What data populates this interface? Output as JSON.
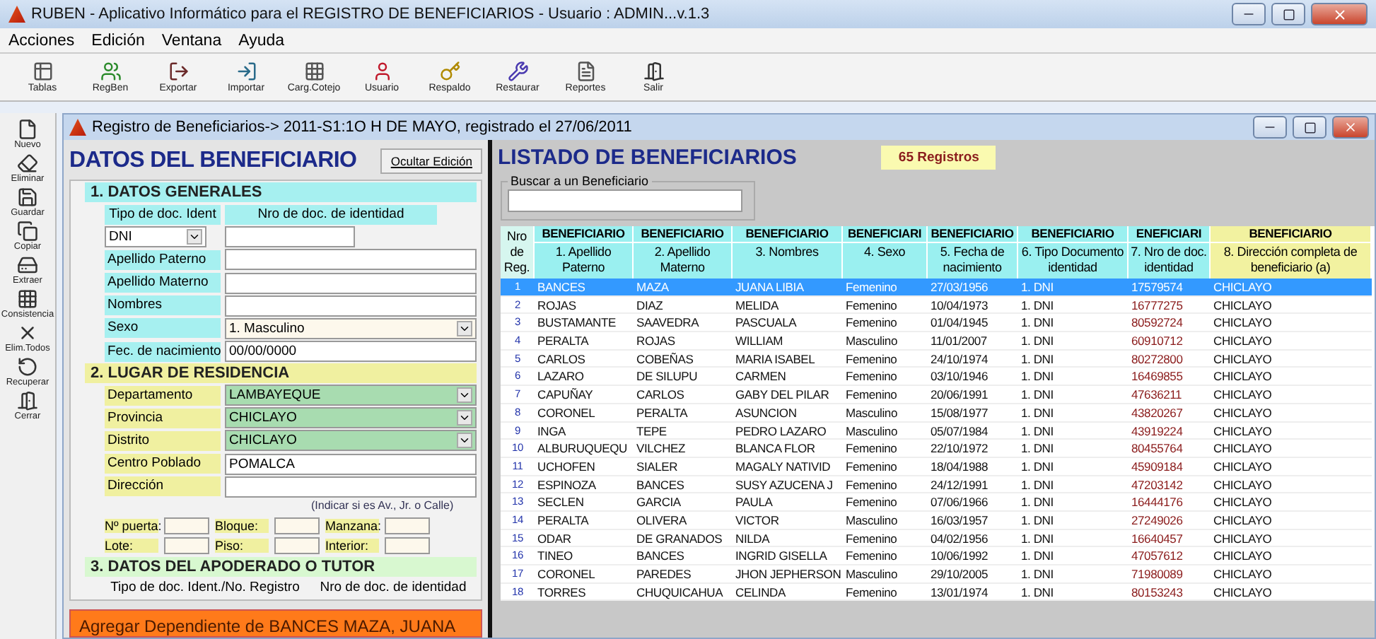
{
  "window": {
    "title": "RUBEN - Aplicativo Informático para el REGISTRO DE BENEFICIARIOS   - Usuario : ADMIN...v.1.3"
  },
  "menu": [
    "Acciones",
    "Edición",
    "Ventana",
    "Ayuda"
  ],
  "toolbar": [
    "Tablas",
    "RegBen",
    "Exportar",
    "Importar",
    "Carg.Cotejo",
    "Usuario",
    "Respaldo",
    "Restaurar",
    "Reportes",
    "Salir"
  ],
  "sidebar": [
    "Nuevo",
    "Eliminar",
    "Guardar",
    "Copiar",
    "Extraer",
    "Consistencia",
    "Elim.Todos",
    "Recuperar",
    "Cerrar"
  ],
  "child_window": {
    "title": "Registro de Beneficiarios-> 2011-S1:1O H DE MAYO, registrado el 27/06/2011"
  },
  "form": {
    "title": "DATOS DEL BENEFICIARIO",
    "hide_button": "Ocultar Edición",
    "sections": [
      {
        "title": "1. DATOS GENERALES",
        "color": "#a6f0f0",
        "rows": [
          {
            "kind": "headers",
            "labels": [
              "Tipo de doc. Ident",
              "Nro de doc. de identidad"
            ]
          },
          {
            "kind": "doc",
            "value": "DNI"
          },
          {
            "kind": "input",
            "label": "Apellido Paterno"
          },
          {
            "kind": "input",
            "label": "Apellido Materno"
          },
          {
            "kind": "input",
            "label": "Nombres"
          },
          {
            "kind": "select",
            "label": "Sexo",
            "value": "1. Masculino",
            "highlighted": false
          },
          {
            "kind": "input",
            "label": "Fec. de nacimiento",
            "value": "00/00/0000"
          }
        ]
      },
      {
        "title": "2. LUGAR DE RESIDENCIA",
        "color": "#f0f0a0",
        "rows": [
          {
            "kind": "select",
            "label": "Departamento",
            "value": "LAMBAYEQUE",
            "highlighted": true
          },
          {
            "kind": "select",
            "label": "Provincia",
            "value": "CHICLAYO",
            "highlighted": true
          },
          {
            "kind": "select",
            "label": "Distrito",
            "value": "CHICLAYO",
            "highlighted": true
          },
          {
            "kind": "input",
            "label": "Centro Poblado",
            "value": "POMALCA"
          },
          {
            "kind": "input",
            "label": "Dirección"
          },
          {
            "kind": "hint",
            "text": "(Indicar si es Av., Jr. o Calle)"
          },
          {
            "kind": "small",
            "labels": [
              "Nº puerta:",
              "Bloque:",
              "Manzana:"
            ]
          },
          {
            "kind": "small",
            "labels": [
              "Lote:",
              "Piso:",
              "Interior:"
            ]
          }
        ]
      },
      {
        "title": "3. DATOS DEL APODERADO O TUTOR",
        "color": "#d8f8d0",
        "rows": [
          {
            "kind": "plainheaders",
            "labels": [
              "Tipo de doc. Ident./No. Registro",
              "Nro de doc. de identidad"
            ]
          }
        ]
      }
    ]
  },
  "add_bar": {
    "text": "Agregar Dependiente de BANCES MAZA, JUANA"
  },
  "list": {
    "title": "LISTADO DE BENEFICIARIOS",
    "count": "65 Registros",
    "search_label": "Buscar a un Beneficiario",
    "number_header": "Nro de Reg.",
    "columns": [
      {
        "group": "BENEFICIARIO",
        "label": "1. Apellido Paterno",
        "highlighted": false
      },
      {
        "group": "BENEFICIARIO",
        "label": "2. Apellido Materno",
        "highlighted": false
      },
      {
        "group": "BENEFICIARIO",
        "label": "3. Nombres",
        "highlighted": false
      },
      {
        "group": "BENEFICIARI",
        "label": "4. Sexo",
        "highlighted": false
      },
      {
        "group": "BENEFICIARIO",
        "label": "5. Fecha de nacimiento",
        "highlighted": false
      },
      {
        "group": "BENEFICIARIO",
        "label": "6. Tipo Documento identidad",
        "highlighted": false
      },
      {
        "group": "ENEFICIARI",
        "label": "7. Nro de doc. identidad",
        "highlighted": false
      },
      {
        "group": "BENEFICIARIO",
        "label": "8. Dirección completa de beneficiario (a)",
        "highlighted": true
      }
    ],
    "rows": [
      {
        "n": "1",
        "selected": true,
        "cells": [
          "BANCES",
          "MAZA",
          "JUANA LIBIA",
          "Femenino",
          "27/03/1956",
          "1. DNI",
          "17579574",
          "CHICLAYO"
        ]
      },
      {
        "n": "2",
        "selected": false,
        "cells": [
          "ROJAS",
          "DIAZ",
          "MELIDA",
          "Femenino",
          "10/04/1973",
          "1. DNI",
          "16777275",
          "CHICLAYO"
        ]
      },
      {
        "n": "3",
        "selected": false,
        "cells": [
          "BUSTAMANTE",
          "SAAVEDRA",
          "PASCUALA",
          "Femenino",
          "01/04/1945",
          "1. DNI",
          "80592724",
          "CHICLAYO"
        ]
      },
      {
        "n": "4",
        "selected": false,
        "cells": [
          "PERALTA",
          "ROJAS",
          "WILLIAM",
          "Masculino",
          "11/01/2007",
          "1. DNI",
          "60910712",
          "CHICLAYO"
        ]
      },
      {
        "n": "5",
        "selected": false,
        "cells": [
          "CARLOS",
          "COBEÑAS",
          "MARIA ISABEL",
          "Femenino",
          "24/10/1974",
          "1. DNI",
          "80272800",
          "CHICLAYO"
        ]
      },
      {
        "n": "6",
        "selected": false,
        "cells": [
          "LAZARO",
          "DE SILUPU",
          "CARMEN",
          "Femenino",
          "03/10/1946",
          "1. DNI",
          "16469855",
          "CHICLAYO"
        ]
      },
      {
        "n": "7",
        "selected": false,
        "cells": [
          "CAPUÑAY",
          "CARLOS",
          "GABY DEL PILAR",
          "Femenino",
          "20/06/1991",
          "1. DNI",
          "47636211",
          "CHICLAYO"
        ]
      },
      {
        "n": "8",
        "selected": false,
        "cells": [
          "CORONEL",
          "PERALTA",
          "ASUNCION",
          "Masculino",
          "15/08/1977",
          "1. DNI",
          "43820267",
          "CHICLAYO"
        ]
      },
      {
        "n": "9",
        "selected": false,
        "cells": [
          "INGA",
          "TEPE",
          "PEDRO LAZARO",
          "Masculino",
          "05/07/1984",
          "1. DNI",
          "43919224",
          "CHICLAYO"
        ]
      },
      {
        "n": "10",
        "selected": false,
        "cells": [
          "ALBURUQUEQU",
          "VILCHEZ",
          "BLANCA FLOR",
          "Femenino",
          "22/10/1972",
          "1. DNI",
          "80455764",
          "CHICLAYO"
        ]
      },
      {
        "n": "11",
        "selected": false,
        "cells": [
          "UCHOFEN",
          "SIALER",
          "MAGALY NATIVID",
          "Femenino",
          "18/04/1988",
          "1. DNI",
          "45909184",
          "CHICLAYO"
        ]
      },
      {
        "n": "12",
        "selected": false,
        "cells": [
          "ESPINOZA",
          "BANCES",
          "SUSY AZUCENA J",
          "Femenino",
          "24/12/1991",
          "1. DNI",
          "47203142",
          "CHICLAYO"
        ]
      },
      {
        "n": "13",
        "selected": false,
        "cells": [
          "SECLEN",
          "GARCIA",
          "PAULA",
          "Femenino",
          "07/06/1966",
          "1. DNI",
          "16444176",
          "CHICLAYO"
        ]
      },
      {
        "n": "14",
        "selected": false,
        "cells": [
          "PERALTA",
          "OLIVERA",
          "VICTOR",
          "Masculino",
          "16/03/1957",
          "1. DNI",
          "27249026",
          "CHICLAYO"
        ]
      },
      {
        "n": "15",
        "selected": false,
        "cells": [
          "ODAR",
          "DE GRANADOS",
          "NILDA",
          "Femenino",
          "04/02/1956",
          "1. DNI",
          "16640457",
          "CHICLAYO"
        ]
      },
      {
        "n": "16",
        "selected": false,
        "cells": [
          "TINEO",
          "BANCES",
          "INGRID GISELLA",
          "Femenino",
          "10/06/1992",
          "1. DNI",
          "47057612",
          "CHICLAYO"
        ]
      },
      {
        "n": "17",
        "selected": false,
        "cells": [
          "CORONEL",
          "PAREDES",
          "JHON JEPHERSON",
          "Masculino",
          "29/10/2005",
          "1. DNI",
          "71980089",
          "CHICLAYO"
        ]
      },
      {
        "n": "18",
        "selected": false,
        "cells": [
          "TORRES",
          "CHUQUICAHUA",
          "CELINDA",
          "Femenino",
          "13/01/1974",
          "1. DNI",
          "80153243",
          "CHICLAYO"
        ]
      }
    ]
  }
}
